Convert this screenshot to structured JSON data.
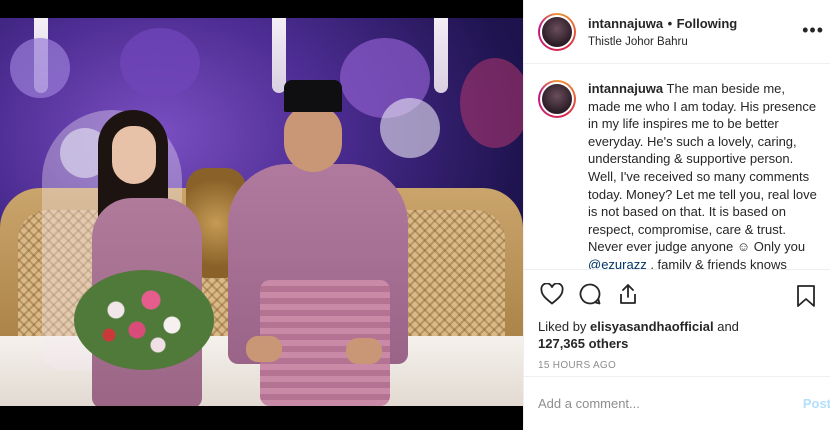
{
  "post": {
    "username": "intannajuwa",
    "separator": "•",
    "follow_state": "Following",
    "location": "Thistle Johor Bahru",
    "more_label": "•••"
  },
  "caption": {
    "username": "intannajuwa",
    "text_before_mention": " The man beside me, made me who I am today. His presence in my life inspires me to be better everyday. He's such a lovely, caring, understanding & supportive person. Well, I've received so many comments today. Money? Let me tell you, real love is not based on that. It is based on respect, compromise, care & trust. Never ever judge anyone ☺ Only you ",
    "mention": "@ezurazz",
    "text_after_mention": " , family & friends knows"
  },
  "likes": {
    "prefix": "Liked by ",
    "liker": "elisyasandhaofficial",
    "and": " and",
    "others": "127,365 others"
  },
  "timestamp": "15 HOURS AGO",
  "comment": {
    "placeholder": "Add a comment...",
    "post_label": "Post"
  }
}
